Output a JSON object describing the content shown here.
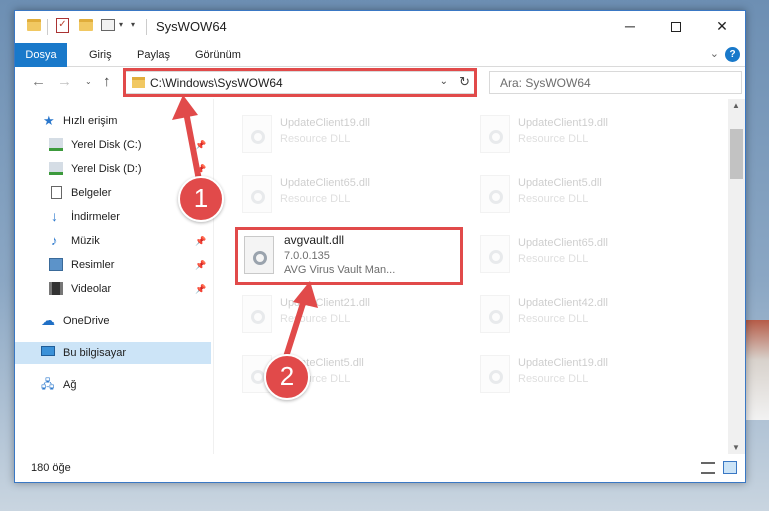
{
  "window": {
    "title": "SysWOW64",
    "controls": {
      "minimize": "─",
      "close": "✕"
    }
  },
  "quick_access_toolbar": {
    "icons": [
      "folder-icon",
      "properties-icon",
      "folder-icon",
      "customize-icon"
    ],
    "dropdown_glyph": "▾"
  },
  "ribbon": {
    "tabs": [
      "Dosya",
      "Giriş",
      "Paylaş",
      "Görünüm"
    ],
    "active_tab": "Dosya",
    "expand_glyph": "⌄",
    "help_label": "?"
  },
  "navigation": {
    "back_glyph": "←",
    "forward_glyph": "→",
    "recent_glyph": "⌄",
    "up_glyph": "↑",
    "address": "C:\\Windows\\SysWOW64",
    "address_dropdown_glyph": "⌄",
    "refresh_glyph": "↻",
    "search_placeholder": "Ara: SysWOW64"
  },
  "sidebar": {
    "items": [
      {
        "label": "Hızlı erişim",
        "icon": "star-icon",
        "pinned": false
      },
      {
        "label": "Yerel Disk (C:)",
        "icon": "drive-icon",
        "pinned": true
      },
      {
        "label": "Yerel Disk (D:)",
        "icon": "drive-icon",
        "pinned": true
      },
      {
        "label": "Belgeler",
        "icon": "documents-icon",
        "pinned": true
      },
      {
        "label": "İndirmeler",
        "icon": "downloads-icon",
        "pinned": true
      },
      {
        "label": "Müzik",
        "icon": "music-icon",
        "pinned": true
      },
      {
        "label": "Resimler",
        "icon": "pictures-icon",
        "pinned": true
      },
      {
        "label": "Videolar",
        "icon": "videos-icon",
        "pinned": true
      },
      {
        "label": "OneDrive",
        "icon": "onedrive-icon",
        "pinned": false
      },
      {
        "label": "Bu bilgisayar",
        "icon": "this-pc-icon",
        "pinned": false,
        "selected": true
      },
      {
        "label": "Ağ",
        "icon": "network-icon",
        "pinned": false
      }
    ],
    "pin_glyph": "📌"
  },
  "files": {
    "left_column": [
      {
        "name": "UpdateClient19.dll",
        "type": "Resource DLL"
      },
      {
        "name": "UpdateClient65.dll",
        "type": "Resource DLL"
      },
      {
        "name": "avgvault.dll",
        "version": "7.0.0.135",
        "description": "AVG Virus Vault Man...",
        "highlighted": true
      },
      {
        "name": "UpdateClient21.dll",
        "type": "Resource DLL"
      },
      {
        "name": "UpdateClient5.dll",
        "type": "Resource DLL"
      }
    ],
    "right_column": [
      {
        "name": "UpdateClient19.dll",
        "type": "Resource DLL"
      },
      {
        "name": "UpdateClient5.dll",
        "type": "Resource DLL"
      },
      {
        "name": "UpdateClient65.dll",
        "type": "Resource DLL"
      },
      {
        "name": "UpdateClient42.dll",
        "type": "Resource DLL"
      },
      {
        "name": "UpdateClient19.dll",
        "type": "Resource DLL"
      }
    ]
  },
  "scrollbar": {
    "up_glyph": "▲",
    "down_glyph": "▼"
  },
  "statusbar": {
    "item_count": "180 öğe"
  },
  "annotations": {
    "step1": "1",
    "step2": "2",
    "color": "#e14a4a"
  },
  "colors": {
    "accent": "#1979ca",
    "selection": "#cce4f7",
    "highlight": "#e14a4a"
  }
}
